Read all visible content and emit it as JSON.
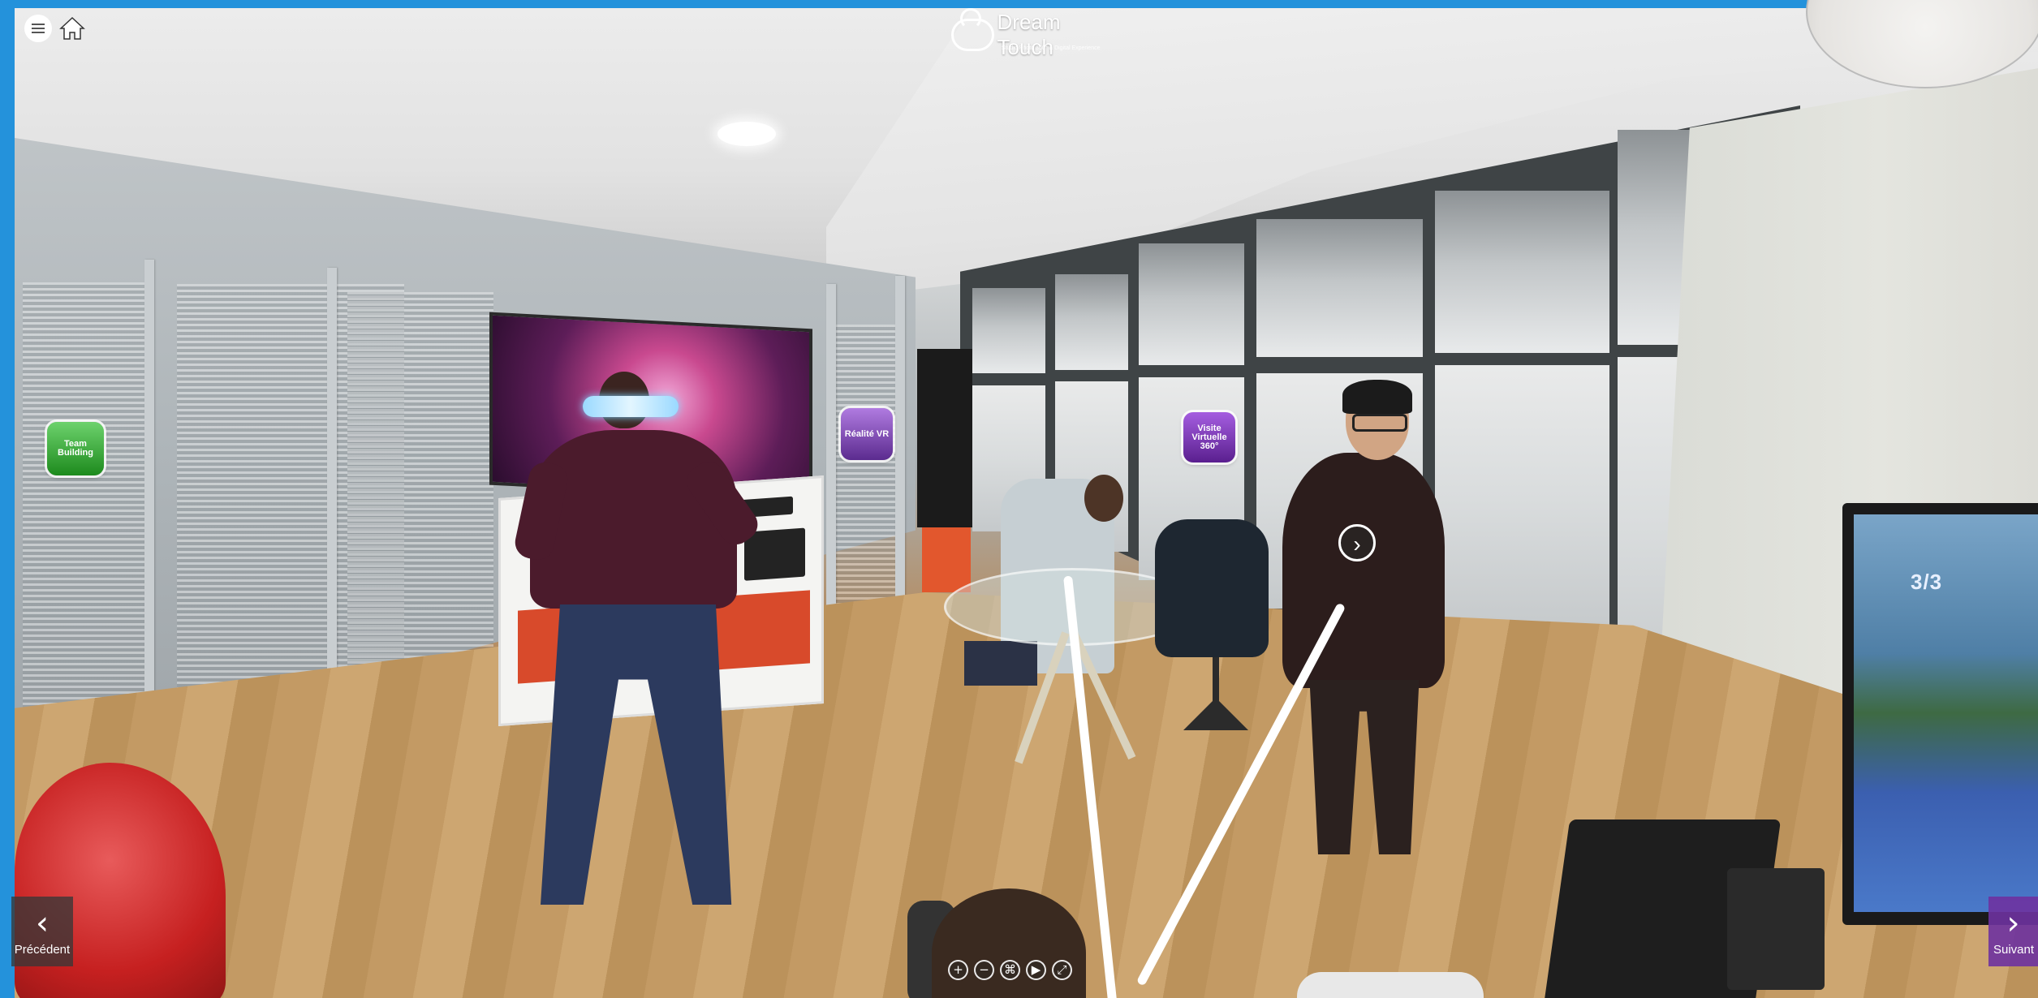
{
  "topbar": {
    "menu_icon": "hamburger-menu-icon",
    "home_icon": "home-icon"
  },
  "logo": {
    "name": "Dream Touch",
    "tagline": "Studio Photo 360° & Digital Experience"
  },
  "hotspots": {
    "team_building": "Team Building",
    "realite_vr": "Réalité VR",
    "visite_virtuelle": "Visite Virtuelle 360°",
    "arrow_icon": "chevron-right-circle-icon"
  },
  "monitor_text": "3/3",
  "navigation": {
    "prev_label": "Précédent",
    "next_label": "Suivant",
    "prev_icon": "chevron-left-icon",
    "next_icon": "chevron-right-icon"
  },
  "zoom_controls": {
    "zoom_in": "+",
    "zoom_out": "−",
    "vr": "⌘",
    "play": "▶",
    "fullscreen": "⤢"
  },
  "colors": {
    "frame_blue": "#2492db",
    "next_purple": "#6e32a0"
  }
}
